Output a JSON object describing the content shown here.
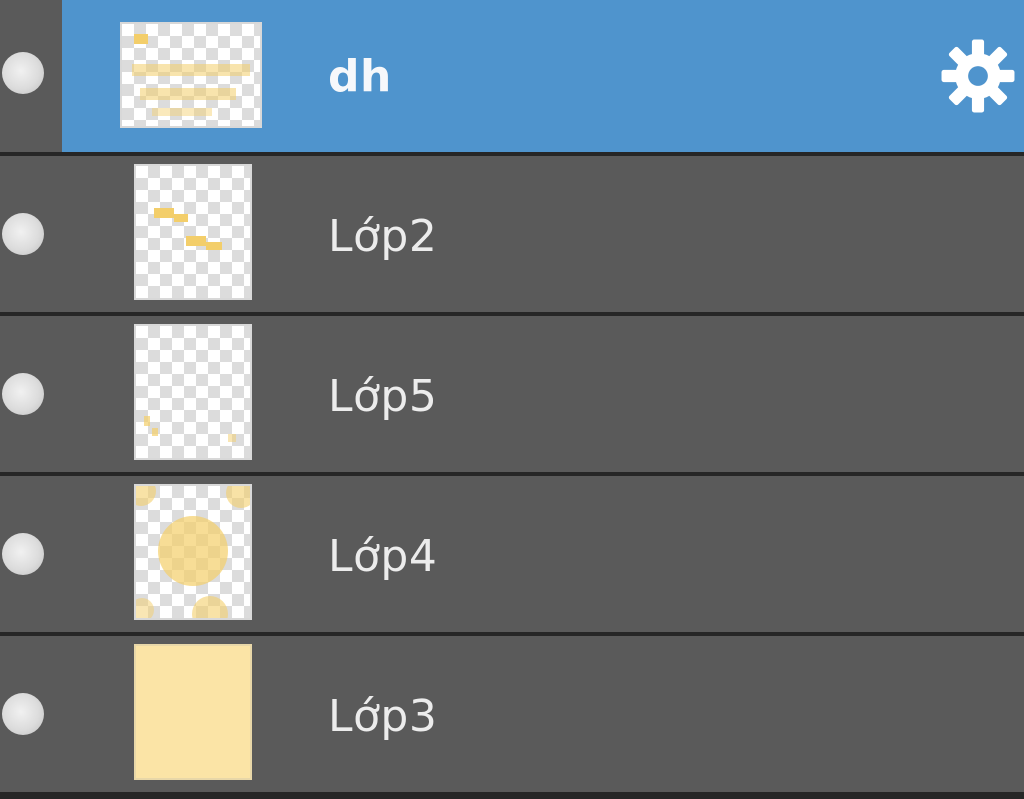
{
  "layers_panel": {
    "layers": [
      {
        "name": "dh",
        "selected": true,
        "visible": true,
        "thumbnail": "transparent-with-text-art"
      },
      {
        "name": "Lớp2",
        "selected": false,
        "visible": true,
        "thumbnail": "transparent-with-small-marks"
      },
      {
        "name": "Lớp5",
        "selected": false,
        "visible": true,
        "thumbnail": "transparent-mostly-empty"
      },
      {
        "name": "Lớp4",
        "selected": false,
        "visible": true,
        "thumbnail": "transparent-with-circles"
      },
      {
        "name": "Lớp3",
        "selected": false,
        "visible": true,
        "thumbnail": "solid-yellow-fill"
      }
    ],
    "selected_icon": "gear-icon",
    "colors": {
      "panel_bg": "#5a5a5a",
      "selected_bg": "#4f94cd",
      "divider": "#262626",
      "layer_fill": "#fbe4a6",
      "mark": "#f3ce6a"
    }
  }
}
